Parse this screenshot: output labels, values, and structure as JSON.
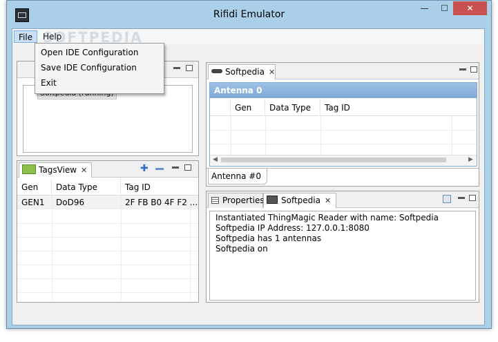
{
  "window": {
    "title": "Rifidi Emulator",
    "close_glyph": "✕",
    "minimize_glyph": "—",
    "maximize_glyph": "☐"
  },
  "menubar": {
    "file": "File",
    "help": "Help"
  },
  "file_menu": {
    "items": [
      "Open IDE Configuration",
      "Save IDE Configuration",
      "Exit"
    ]
  },
  "watermark": "SOFTPEDIA",
  "reader_panel": {
    "tree_item": "Softpedia (running)"
  },
  "tags_view": {
    "tab_label": "TagsView",
    "columns": [
      "Gen",
      "Data Type",
      "Tag ID"
    ],
    "rows": [
      {
        "gen": "GEN1",
        "data_type": "DoD96",
        "tag_id": "2F FB B0 4F F2 ..."
      }
    ]
  },
  "antenna_view": {
    "tab_label": "Softpedia",
    "antenna_title": "Antenna 0",
    "columns": [
      "Gen",
      "Data Type",
      "Tag ID"
    ],
    "bottom_tab": "Antenna #0"
  },
  "console_view": {
    "tabs": [
      "Properties",
      "Softpedia"
    ],
    "lines": [
      "Instantiated ThingMagic Reader with name: Softpedia",
      "Softpedia IP Address: 127.0.0.1:8080",
      "Softpedia has 1 antennas",
      "Softpedia on"
    ]
  },
  "colors": {
    "accent": "#7ea9d6",
    "close_button": "#c75050",
    "titlebar": "#a9cfe9"
  }
}
